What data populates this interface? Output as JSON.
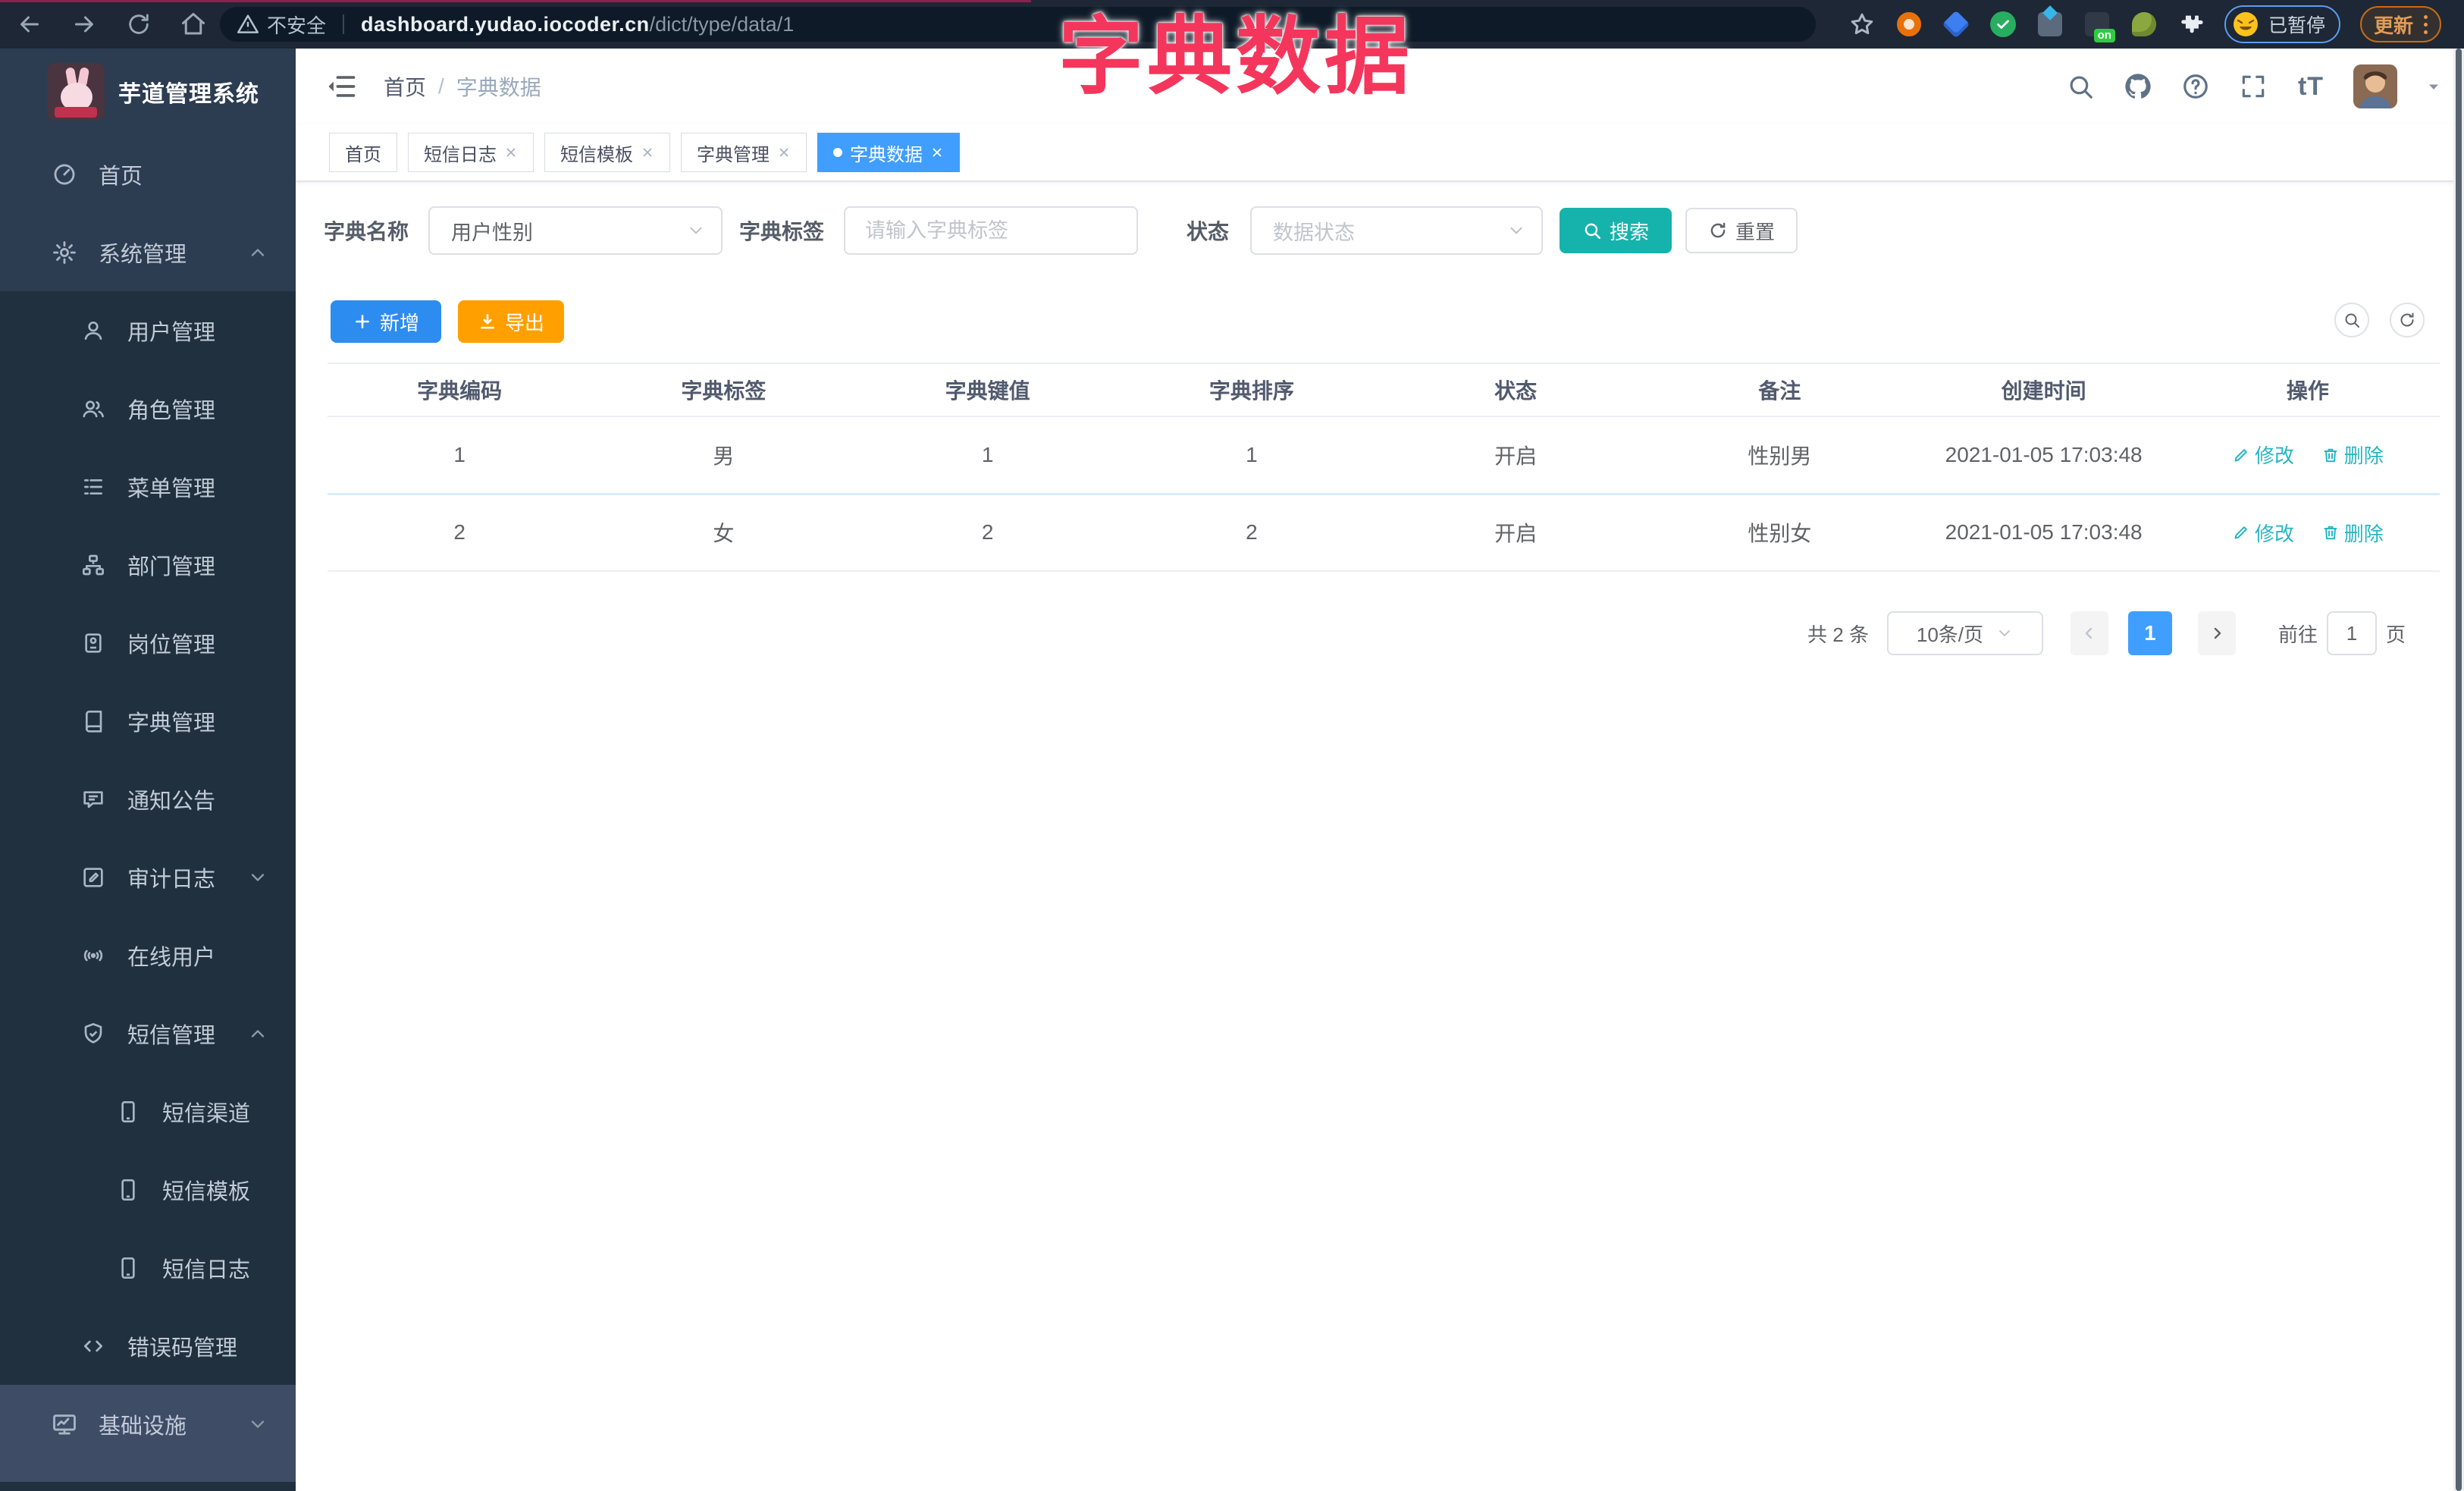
{
  "browser": {
    "security_label": "不安全",
    "url_domain": "dashboard.yudao.iocoder.cn",
    "url_path": "/dict/type/data/1",
    "profile_status": "已暂停",
    "update_label": "更新",
    "ext_on_badge": "on"
  },
  "overlay_title": "字典数据",
  "sidebar": {
    "app_title": "芋道管理系统",
    "items": [
      {
        "label": "首页",
        "level": 0
      },
      {
        "label": "系统管理",
        "level": 0,
        "caret": "up"
      },
      {
        "label": "用户管理",
        "level": 1
      },
      {
        "label": "角色管理",
        "level": 1
      },
      {
        "label": "菜单管理",
        "level": 1
      },
      {
        "label": "部门管理",
        "level": 1
      },
      {
        "label": "岗位管理",
        "level": 1
      },
      {
        "label": "字典管理",
        "level": 1
      },
      {
        "label": "通知公告",
        "level": 1
      },
      {
        "label": "审计日志",
        "level": 1,
        "caret": "down"
      },
      {
        "label": "在线用户",
        "level": 1
      },
      {
        "label": "短信管理",
        "level": 1,
        "caret": "up"
      },
      {
        "label": "短信渠道",
        "level": 2
      },
      {
        "label": "短信模板",
        "level": 2
      },
      {
        "label": "短信日志",
        "level": 2
      },
      {
        "label": "错误码管理",
        "level": 1
      },
      {
        "label": "基础设施",
        "level": 0,
        "caret": "down",
        "highlighted": true
      }
    ]
  },
  "navbar": {
    "breadcrumb_home": "首页",
    "breadcrumb_separator": "/",
    "breadcrumb_current": "字典数据"
  },
  "tabs": [
    {
      "label": "首页",
      "closable": false,
      "active": false
    },
    {
      "label": "短信日志",
      "closable": true,
      "active": false
    },
    {
      "label": "短信模板",
      "closable": true,
      "active": false
    },
    {
      "label": "字典管理",
      "closable": true,
      "active": false
    },
    {
      "label": "字典数据",
      "closable": true,
      "active": true
    }
  ],
  "filters": {
    "dict_name_label": "字典名称",
    "dict_name_value": "用户性别",
    "dict_label_label": "字典标签",
    "dict_label_placeholder": "请输入字典标签",
    "status_label": "状态",
    "status_placeholder": "数据状态",
    "search_label": "搜索",
    "reset_label": "重置"
  },
  "toolbar": {
    "add_label": "新增",
    "export_label": "导出"
  },
  "table": {
    "columns": [
      "字典编码",
      "字典标签",
      "字典键值",
      "字典排序",
      "状态",
      "备注",
      "创建时间",
      "操作"
    ],
    "rows": [
      {
        "code": "1",
        "label": "男",
        "value": "1",
        "sort": "1",
        "status": "开启",
        "remark": "性别男",
        "created": "2021-01-05 17:03:48"
      },
      {
        "code": "2",
        "label": "女",
        "value": "2",
        "sort": "2",
        "status": "开启",
        "remark": "性别女",
        "created": "2021-01-05 17:03:48"
      }
    ],
    "edit_label": "修改",
    "delete_label": "删除"
  },
  "pagination": {
    "total_label": "共 2 条",
    "page_size": "10条/页",
    "current_page": "1",
    "goto_label": "前往",
    "goto_value": "1",
    "page_unit": "页"
  },
  "colors": {
    "accent_blue": "#409eff",
    "search_teal": "#16b3ac",
    "add_blue": "#2d8cf0",
    "export_orange": "#ff9f00",
    "overlay_pink": "#f5365c",
    "action_link_teal": "#27b5c3",
    "sidebar_bg": "#20303f",
    "browser_bar_bg": "#1d2735"
  }
}
